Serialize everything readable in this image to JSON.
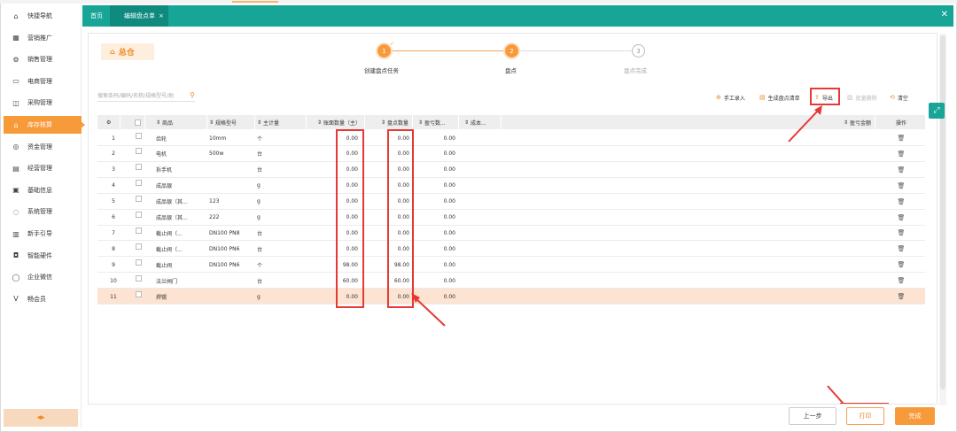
{
  "sidebar": {
    "items": [
      {
        "label": "快捷导航",
        "icon": "home-icon",
        "glyph": "⌂"
      },
      {
        "label": "营销推广",
        "icon": "calendar-icon",
        "glyph": "▦"
      },
      {
        "label": "销售管理",
        "icon": "gear-icon",
        "glyph": "⚙"
      },
      {
        "label": "电商管理",
        "icon": "monitor-icon",
        "glyph": "▭"
      },
      {
        "label": "采购管理",
        "icon": "bag-icon",
        "glyph": "◫"
      },
      {
        "label": "库存核算",
        "icon": "warehouse-icon",
        "glyph": "⌂"
      },
      {
        "label": "资金管理",
        "icon": "money-icon",
        "glyph": "◎"
      },
      {
        "label": "经营管理",
        "icon": "clipboard-icon",
        "glyph": "▤"
      },
      {
        "label": "基础信息",
        "icon": "id-card-icon",
        "glyph": "▣"
      },
      {
        "label": "系统管理",
        "icon": "system-icon",
        "glyph": "◌"
      },
      {
        "label": "新手引导",
        "icon": "guide-icon",
        "glyph": "▥"
      },
      {
        "label": "智能硬件",
        "icon": "hardware-icon",
        "glyph": "◘"
      },
      {
        "label": "企业微信",
        "icon": "wechat-icon",
        "glyph": "◯"
      },
      {
        "label": "畅会员",
        "icon": "vip-icon",
        "glyph": "V"
      }
    ],
    "active_index": 5,
    "collapse_glyph": "◂▸"
  },
  "tabs": {
    "home": "首页",
    "current": "编辑盘点单",
    "current_close": "×",
    "close_all": "✕"
  },
  "warehouse": {
    "label": "总仓",
    "glyph": "⌂"
  },
  "steps": [
    {
      "num": "1",
      "label": "创建盘点任务",
      "state": "done"
    },
    {
      "num": "2",
      "label": "盘点",
      "state": "current"
    },
    {
      "num": "3",
      "label": "盘点完成",
      "state": "todo"
    }
  ],
  "search": {
    "placeholder": "搜索条码/编码/名称/规格型号/助",
    "icon": "search-icon"
  },
  "actions": [
    {
      "label": "手工录入",
      "glyph": "⊕",
      "enabled": true
    },
    {
      "label": "生成盘点清单",
      "glyph": "▤",
      "enabled": true
    },
    {
      "label": "导出",
      "glyph": "⇪",
      "enabled": true
    },
    {
      "label": "批量删除",
      "glyph": "▥",
      "enabled": false
    },
    {
      "label": "清空",
      "glyph": "⟲",
      "enabled": true
    }
  ],
  "table": {
    "headers": {
      "settings": "⚙",
      "goods": "商品",
      "spec": "规格型号",
      "unit": "主计量",
      "book_qty": "账面数量（主）",
      "count_qty": "盘点数量",
      "diff_qty": "盈亏数...",
      "cost": "成本...",
      "diff_amount": "盈亏金额",
      "ops": "操作"
    },
    "rows": [
      {
        "no": "1",
        "goods": "齿轮",
        "spec": "10mm",
        "unit": "个",
        "book": "0.00",
        "count": "0.00",
        "diff": "0.00"
      },
      {
        "no": "2",
        "goods": "电机",
        "spec": "500w",
        "unit": "台",
        "book": "0.00",
        "count": "0.00",
        "diff": "0.00"
      },
      {
        "no": "3",
        "goods": "拆手机",
        "spec": "",
        "unit": "台",
        "book": "0.00",
        "count": "0.00",
        "diff": "0.00"
      },
      {
        "no": "4",
        "goods": "成品银",
        "spec": "",
        "unit": "g",
        "book": "0.00",
        "count": "0.00",
        "diff": "0.00"
      },
      {
        "no": "5",
        "goods": "成品银（其...",
        "spec": "123",
        "unit": "g",
        "book": "0.00",
        "count": "0.00",
        "diff": "0.00"
      },
      {
        "no": "6",
        "goods": "成品银（其...",
        "spec": "222",
        "unit": "g",
        "book": "0.00",
        "count": "0.00",
        "diff": "0.00"
      },
      {
        "no": "7",
        "goods": "截止阀（...",
        "spec": "DN100 PN8",
        "unit": "台",
        "book": "0.00",
        "count": "0.00",
        "diff": "0.00"
      },
      {
        "no": "8",
        "goods": "截止阀（...",
        "spec": "DN100 PN6",
        "unit": "台",
        "book": "0.00",
        "count": "0.00",
        "diff": "0.00"
      },
      {
        "no": "9",
        "goods": "截止阀",
        "spec": "DN100 PN6",
        "unit": "个",
        "book": "98.00",
        "count": "98.00",
        "diff": "0.00"
      },
      {
        "no": "10",
        "goods": "法兰闸门",
        "spec": "",
        "unit": "台",
        "book": "60.00",
        "count": "60.00",
        "diff": "0.00"
      },
      {
        "no": "11",
        "goods": "焊锡",
        "spec": "",
        "unit": "g",
        "book": "0.00",
        "count": "0.00",
        "diff": "0.00"
      }
    ],
    "highlight_row": 11,
    "trash_glyph": "🗑"
  },
  "footer": {
    "prev": "上一步",
    "print": "打印",
    "done": "完成"
  },
  "float_button_glyph": "⤢",
  "colors": {
    "accent": "#f79a3a",
    "teal": "#16a597",
    "annotation": "#e53935",
    "highlight_row": "#fde3d1"
  }
}
